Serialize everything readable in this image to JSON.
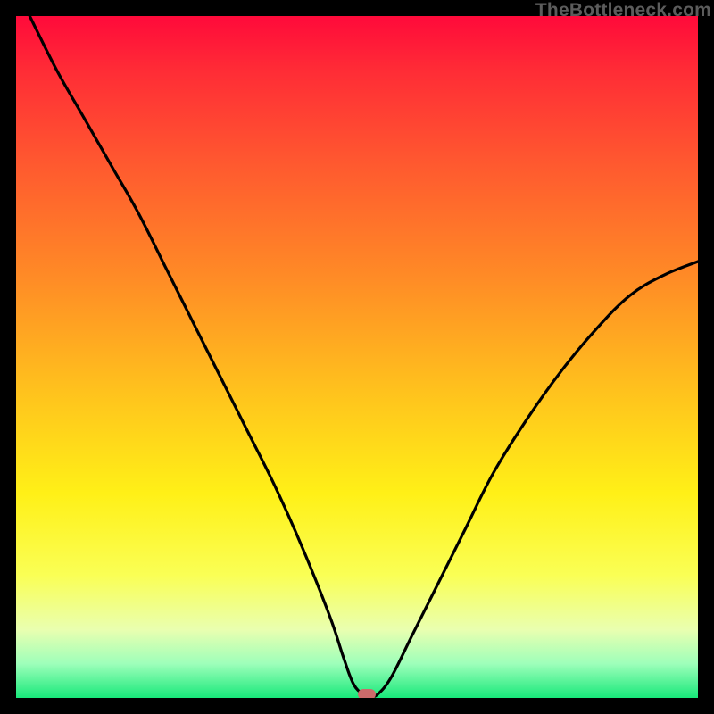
{
  "watermark": "TheBottleneck.com",
  "colors": {
    "frame": "#000000",
    "curve": "#000000",
    "marker": "#cc6a6a"
  },
  "chart_data": {
    "type": "line",
    "title": "",
    "xlabel": "",
    "ylabel": "",
    "xlim": [
      0,
      100
    ],
    "ylim": [
      0,
      100
    ],
    "grid": false,
    "legend": false,
    "series": [
      {
        "name": "bottleneck-curve",
        "x": [
          2,
          6,
          10,
          14,
          18,
          22,
          26,
          30,
          34,
          38,
          42,
          46,
          48,
          49.5,
          51,
          52,
          53,
          55,
          58,
          62,
          66,
          70,
          75,
          80,
          85,
          90,
          95,
          100
        ],
        "y": [
          100,
          92,
          85,
          78,
          71,
          63,
          55,
          47,
          39,
          31,
          22,
          12,
          6,
          2,
          0.5,
          0.3,
          0.5,
          3,
          9,
          17,
          25,
          33,
          41,
          48,
          54,
          59,
          62,
          64
        ]
      }
    ],
    "marker": {
      "x": 51.5,
      "y": 0.5
    },
    "background_gradient": {
      "direction": "top_to_bottom",
      "stops": [
        {
          "pos": 0,
          "color": "#ff0a3a"
        },
        {
          "pos": 8,
          "color": "#ff2c36"
        },
        {
          "pos": 22,
          "color": "#ff5a2f"
        },
        {
          "pos": 38,
          "color": "#ff8a26"
        },
        {
          "pos": 55,
          "color": "#ffc21d"
        },
        {
          "pos": 70,
          "color": "#fff017"
        },
        {
          "pos": 82,
          "color": "#faff55"
        },
        {
          "pos": 90,
          "color": "#e9ffb0"
        },
        {
          "pos": 95,
          "color": "#9dffba"
        },
        {
          "pos": 100,
          "color": "#18e87a"
        }
      ]
    }
  }
}
